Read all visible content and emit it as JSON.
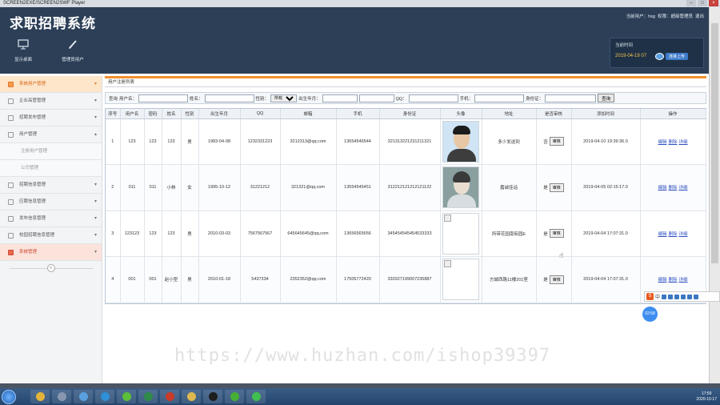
{
  "window": {
    "title": "SCREEN2EXE/SCREEN2SWF Player"
  },
  "header": {
    "app_title": "求职招聘系统",
    "user_bar": [
      "当前用户：hsg",
      "权限：超级管理员",
      "退出"
    ],
    "nav": [
      {
        "label": "显示桌面",
        "icon": "monitor-icon"
      },
      {
        "label": "管理员用户",
        "icon": "pencil-icon"
      }
    ],
    "time_box": {
      "label": "当前时间",
      "value": "2019-04-19 07",
      "upload": "连接上传"
    }
  },
  "sidebar": {
    "items": [
      {
        "label": "系统用户管理",
        "active": true
      },
      {
        "label": "企业高管管理"
      },
      {
        "label": "招聘发布管理"
      },
      {
        "label": "用户管理",
        "expanded": true
      },
      {
        "label": "注册用户管理",
        "sub": true
      },
      {
        "label": "公司管理",
        "sub": true
      },
      {
        "label": "招聘信息管理"
      },
      {
        "label": "应聘信息管理"
      },
      {
        "label": "发布信息管理"
      },
      {
        "label": "校园招聘信息管理"
      },
      {
        "label": "系统管理",
        "red": true
      }
    ],
    "collapse": "«"
  },
  "main": {
    "breadcrumb": "用户注册列表",
    "search": {
      "label_query": "查询",
      "label_username": "用户名：",
      "label_name": "姓名：",
      "label_gender": "性别：",
      "gender_selected": "所有",
      "label_birth": "出生年月：",
      "label_qq": "QQ：",
      "label_phone": "手机：",
      "label_idcard": "身份证：",
      "button": "查询"
    },
    "columns": [
      "序号",
      "用户名",
      "密码",
      "姓名",
      "性别",
      "出生年月",
      "QQ",
      "邮箱",
      "手机",
      "身份证",
      "头像",
      "地址",
      "是否审核",
      "添加时间",
      "操作"
    ],
    "rows": [
      {
        "no": "1",
        "username": "123",
        "password": "123",
        "name": "123",
        "gender": "男",
        "birth": "1983-04-08",
        "qq": "1232331223",
        "email": "3212313@qq.com",
        "phone": "13654546544",
        "idcard": "321313221231211321",
        "avatar": "photo-1",
        "address": "多少发送到",
        "audited": "否",
        "added": "2019-04-10 19:39:36.0"
      },
      {
        "no": "2",
        "username": "011",
        "password": "011",
        "name": "小林",
        "gender": "女",
        "birth": "1995-10-12",
        "qq": "31221212",
        "email": "321321@qq.com",
        "phone": "13554545451",
        "idcard": "312212121212121122",
        "avatar": "photo-2",
        "address": "嘉诚佳话",
        "audited": "是",
        "added": "2019-04-05 02:15:17.0"
      },
      {
        "no": "3",
        "username": "123123",
        "password": "123",
        "name": "123",
        "gender": "男",
        "birth": "2010-03-03",
        "qq": "7567567567",
        "email": "645645645@qq.com",
        "phone": "13656565656",
        "idcard": "345454545454533333",
        "avatar": "broken",
        "address": "所带花园南街园E",
        "audited": "是",
        "added": "2019-04-04 17:07:31.0"
      },
      {
        "no": "4",
        "username": "001",
        "password": "001",
        "name": "赵小型",
        "gender": "男",
        "birth": "2010-01-18",
        "qq": "5437334",
        "email": "2352352@qq.com",
        "phone": "17505772420",
        "idcard": "330327199007235887",
        "avatar": "broken",
        "address": "方城西路11楼201室",
        "audited": "是",
        "added": "2019-04-04 17:07:31.0"
      }
    ],
    "audit_button": "审核",
    "ops": {
      "edit": "编辑",
      "delete": "删除",
      "detail": "详细"
    }
  },
  "watermark": "https://www.huzhan.com/ishop39397",
  "overlay": {
    "ime": "中",
    "ball": "02:58"
  },
  "taskbar": {
    "time": "17:59",
    "date": "2020-10-17"
  }
}
